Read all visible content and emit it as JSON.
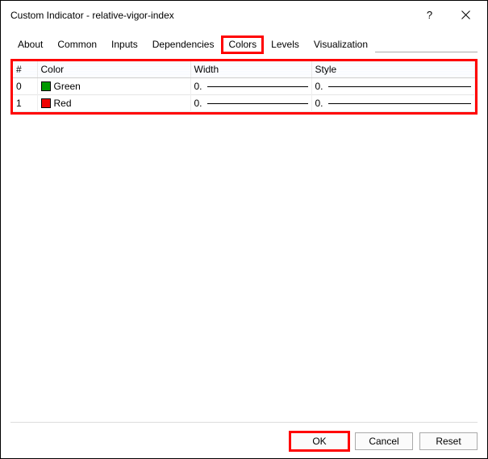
{
  "window": {
    "title": "Custom Indicator - relative-vigor-index"
  },
  "tabs": [
    {
      "label": "About"
    },
    {
      "label": "Common"
    },
    {
      "label": "Inputs"
    },
    {
      "label": "Dependencies"
    },
    {
      "label": "Colors",
      "active": true
    },
    {
      "label": "Levels"
    },
    {
      "label": "Visualization"
    }
  ],
  "table": {
    "headers": {
      "index": "#",
      "color": "Color",
      "width": "Width",
      "style": "Style"
    },
    "rows": [
      {
        "index": "0",
        "color_name": "Green",
        "swatch": "green",
        "width": "0.",
        "style": "0."
      },
      {
        "index": "1",
        "color_name": "Red",
        "swatch": "red",
        "width": "0.",
        "style": "0."
      }
    ]
  },
  "buttons": {
    "ok": "OK",
    "cancel": "Cancel",
    "reset": "Reset"
  }
}
